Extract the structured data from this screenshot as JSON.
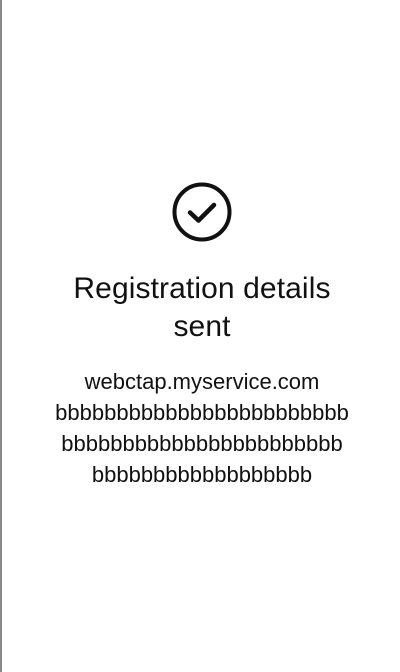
{
  "confirmation": {
    "icon": "check-circle-icon",
    "title": "Registration details sent",
    "details": {
      "url": "webctap.myservice.com",
      "line_2": "bbbbbbbbbbbbbbbbbbbbbbbb",
      "line_3": "bbbbbbbbbbbbbbbbbbbbbbb",
      "line_4": "bbbbbbbbbbbbbbbbbb"
    }
  },
  "colors": {
    "background": "#ffffff",
    "text": "#111111",
    "left_border": "#8a8a8a"
  }
}
